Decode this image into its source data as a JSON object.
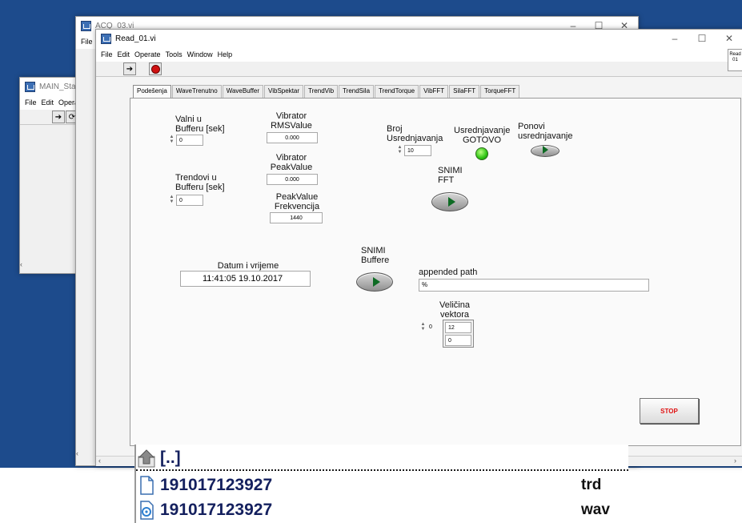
{
  "windows": {
    "main": {
      "title": "MAIN_StartAll",
      "menu": [
        "File",
        "Edit",
        "Opera"
      ]
    },
    "acq": {
      "title": "ACQ_03.vi",
      "menu": [
        "File"
      ]
    },
    "read": {
      "title": "Read_01.vi",
      "menu": [
        "File",
        "Edit",
        "Operate",
        "Tools",
        "Window",
        "Help"
      ],
      "side_label": "Read 01"
    }
  },
  "window_controls": {
    "minimize": "–",
    "maximize": "☐",
    "close": "✕"
  },
  "tabs": [
    "Podešenja",
    "WaveTrenutno",
    "WaveBuffer",
    "VibSpektar",
    "TrendVib",
    "TrendSila",
    "TrendTorque",
    "VibFFT",
    "SilaFFT",
    "TorqueFFT"
  ],
  "panel": {
    "valni_label": "Valni u Bufferu [sek]",
    "valni_value": "0",
    "trendovi_label": "Trendovi u Bufferu [sek]",
    "trendovi_value": "0",
    "rms_label": "Vibrator RMSValue",
    "rms_value": "0.000",
    "peak_label": "Vibrator PeakValue",
    "peak_value": "0.000",
    "freq_label": "PeakValue Frekvencija",
    "freq_value": "1440",
    "broj_label": "Broj Usrednjavanja",
    "broj_value": "10",
    "gotovo_label": "Usrednjavanje GOTOVO",
    "ponovi_label": "Ponovi usrednjavanje",
    "snimi_fft_label": "SNIMI FFT",
    "datum_label": "Datum i vrijeme",
    "datum_value": "11:41:05  19.10.2017",
    "snimi_buffere_label": "SNIMI Buffere",
    "path_label": "appended path",
    "path_value": "%",
    "velicina_label": "Veličina vektora",
    "velicina_index": "0",
    "velicina_values": [
      "12",
      "0"
    ],
    "stop_label": "STOP"
  },
  "files": [
    {
      "name": "[..]",
      "ext": "",
      "icon": "up-folder-icon"
    },
    {
      "name": "191017123927",
      "ext": "trd",
      "icon": "document-icon"
    },
    {
      "name": "191017123927",
      "ext": "wav",
      "icon": "audio-file-icon"
    }
  ]
}
